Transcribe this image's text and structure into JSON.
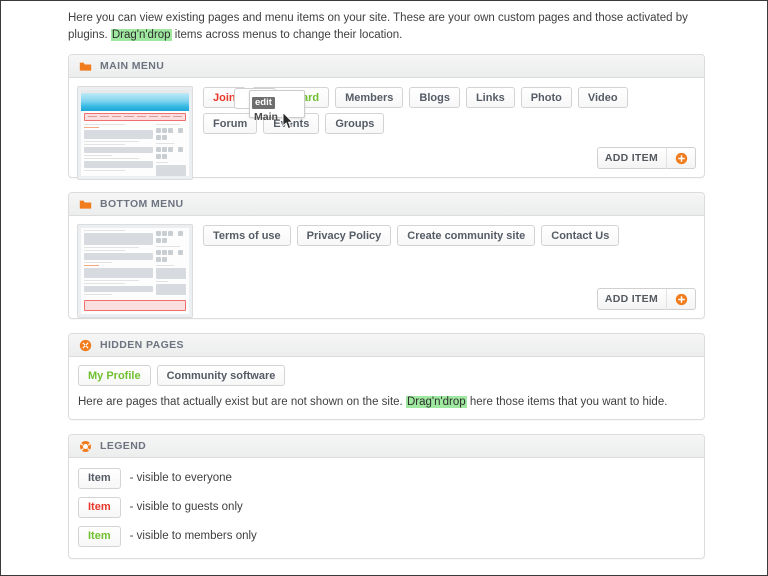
{
  "intro": {
    "text_before": "Here you can view existing pages and menu items on your site. These are your own custom pages and those activated by plugins. ",
    "highlight": "Drag'n'drop",
    "text_after": " items across menus to change their location."
  },
  "colors": {
    "accent_orange": "#f07c1e",
    "everyone": "#555c66",
    "guests_only": "#e8372a",
    "members_only": "#6fbf2f",
    "highlight_bg": "#9fe89f",
    "panel_border": "#dcdcdc",
    "header_text": "#6d7480"
  },
  "sections": {
    "main_menu": {
      "title": "MAIN MENU",
      "icon": "folder-icon",
      "thumbnail_name": "main-menu-preview-thumbnail",
      "add_item_label": "ADD ITEM",
      "add_item_icon": "plus-circle-icon",
      "items": [
        {
          "label": "Join",
          "visibility": "guests"
        },
        {
          "label": "Dashboard",
          "visibility": "members"
        },
        {
          "label": "Members",
          "visibility": "everyone"
        },
        {
          "label": "Blogs",
          "visibility": "everyone"
        },
        {
          "label": "Links",
          "visibility": "everyone"
        },
        {
          "label": "Photo",
          "visibility": "everyone"
        },
        {
          "label": "Video",
          "visibility": "everyone"
        },
        {
          "label": "Forum",
          "visibility": "everyone"
        },
        {
          "label": "Events",
          "visibility": "everyone"
        },
        {
          "label": "Groups",
          "visibility": "everyone"
        }
      ],
      "edit_popup": {
        "badge": "edit",
        "name": "Main"
      }
    },
    "bottom_menu": {
      "title": "BOTTOM MENU",
      "icon": "folder-icon",
      "thumbnail_name": "bottom-menu-preview-thumbnail",
      "add_item_label": "ADD ITEM",
      "add_item_icon": "plus-circle-icon",
      "items": [
        {
          "label": "Terms of use",
          "visibility": "everyone"
        },
        {
          "label": "Privacy Policy",
          "visibility": "everyone"
        },
        {
          "label": "Create community site",
          "visibility": "everyone"
        },
        {
          "label": "Contact Us",
          "visibility": "everyone"
        }
      ]
    },
    "hidden_pages": {
      "title": "HIDDEN PAGES",
      "icon": "x-circle-icon",
      "items": [
        {
          "label": "My Profile",
          "visibility": "members"
        },
        {
          "label": "Community software",
          "visibility": "everyone"
        }
      ],
      "note_before": "Here are pages that actually exist but are not shown on the site. ",
      "note_highlight": "Drag'n'drop",
      "note_after": " here those items that you want to hide."
    },
    "legend": {
      "title": "LEGEND",
      "icon": "lifebuoy-icon",
      "rows": [
        {
          "sample": "Item",
          "visibility": "everyone",
          "description": "- visible to everyone"
        },
        {
          "sample": "Item",
          "visibility": "guests",
          "description": "- visible to guests only"
        },
        {
          "sample": "Item",
          "visibility": "members",
          "description": "- visible to members only"
        }
      ]
    }
  }
}
